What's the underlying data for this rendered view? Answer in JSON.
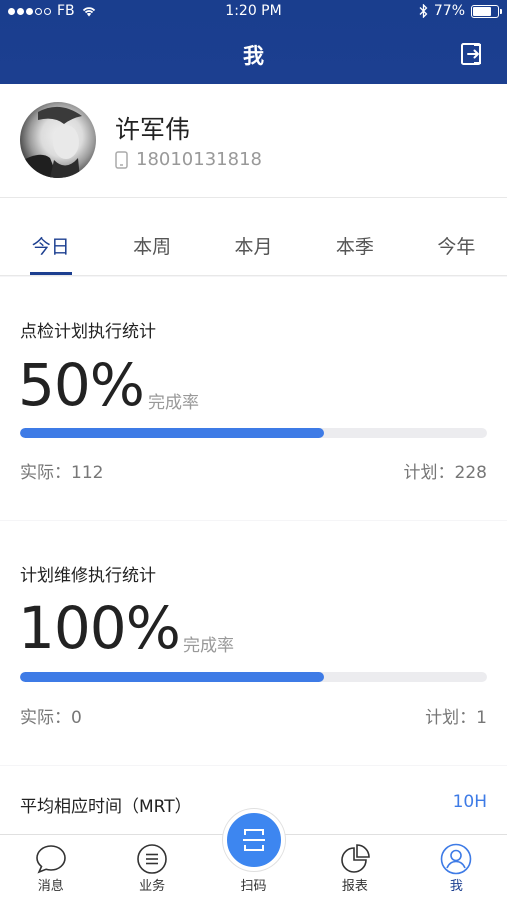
{
  "status": {
    "carrier": "FB",
    "time": "1:20 PM",
    "battery": "77%",
    "battery_level": 0.77
  },
  "nav": {
    "title": "我",
    "logout_icon": "logout-icon"
  },
  "profile": {
    "name": "许军伟",
    "phone": "18010131818"
  },
  "tabs": [
    {
      "label": "今日",
      "active": true
    },
    {
      "label": "本周",
      "active": false
    },
    {
      "label": "本月",
      "active": false
    },
    {
      "label": "本季",
      "active": false
    },
    {
      "label": "今年",
      "active": false
    }
  ],
  "inspection": {
    "title": "点检计划执行统计",
    "percent": "50%",
    "rate_label": "完成率",
    "progress": 0.65,
    "actual": "实际：112",
    "plan": "计划：228"
  },
  "maintenance": {
    "title": "计划维修执行统计",
    "percent": "100%",
    "rate_label": "完成率",
    "progress": 0.65,
    "actual": "实际：0",
    "plan": "计划：1"
  },
  "mrt": {
    "title": "平均相应时间（MRT）",
    "value": "10H"
  },
  "tabbar": [
    {
      "label": "消息",
      "icon": "message-icon"
    },
    {
      "label": "业务",
      "icon": "business-icon"
    },
    {
      "label": "扫码",
      "icon": "scan-icon"
    },
    {
      "label": "报表",
      "icon": "report-icon"
    },
    {
      "label": "我",
      "icon": "profile-icon",
      "active": true
    }
  ],
  "colors": {
    "header": "#1c3f90",
    "accent": "#3e7be6",
    "scan": "#3d86f0"
  }
}
